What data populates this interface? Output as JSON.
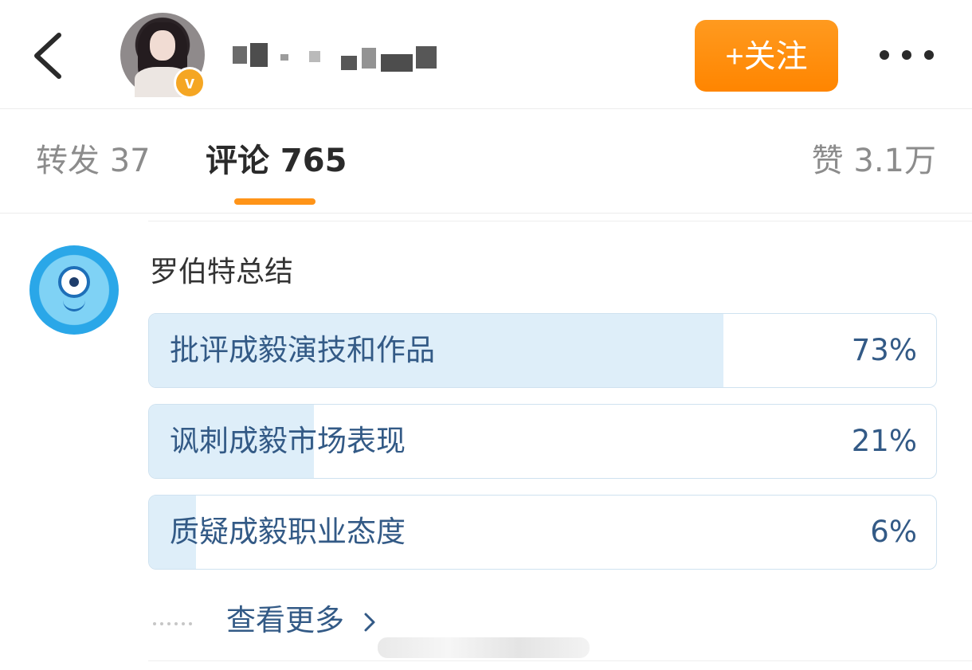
{
  "header": {
    "follow_label": "+关注",
    "badge_symbol": "v"
  },
  "tabs": {
    "repost": "转发 37",
    "comments": "评论 765",
    "likes": "赞 3.1万"
  },
  "summary": {
    "title": "罗伯特总结",
    "items": [
      {
        "label": "批评成毅演技和作品",
        "percent_text": "73%",
        "share": 0.73
      },
      {
        "label": "讽刺成毅市场表现",
        "percent_text": "21%",
        "share": 0.21
      },
      {
        "label": "质疑成毅职业态度",
        "percent_text": "6%",
        "share": 0.06
      }
    ],
    "see_more": "查看更多"
  },
  "colors": {
    "accent": "#ff8a00",
    "link": "#335a86",
    "bar_fill": "#deeef9"
  },
  "icons": [
    "back-icon",
    "verified-icon",
    "more-icon",
    "robot-avatar-icon",
    "chevron-right-icon"
  ]
}
